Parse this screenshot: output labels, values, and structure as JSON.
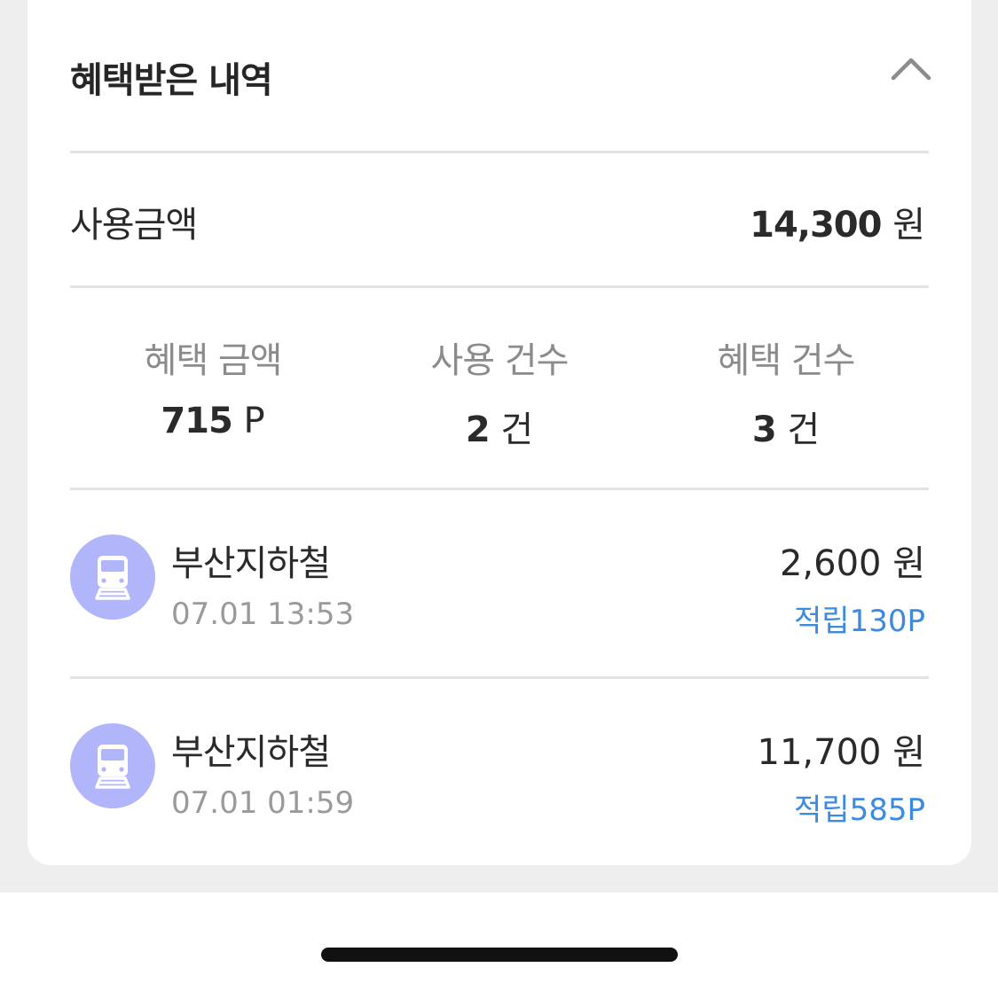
{
  "colors": {
    "page_background": "#eeeeee",
    "card_background": "#ffffff",
    "icon_circle": "#b1b6fb",
    "reward_text": "#3d8be0",
    "muted_text": "#9a9a9a"
  },
  "header": {
    "title": "혜택받은 내역",
    "collapse_icon": "chevron-up-icon"
  },
  "summary": {
    "total_label": "사용금액",
    "total_amount": "14,300",
    "total_unit": "원"
  },
  "stats": [
    {
      "label": "혜택 금액",
      "value": "715",
      "unit": "P"
    },
    {
      "label": "사용 건수",
      "value": "2",
      "unit": "건"
    },
    {
      "label": "혜택 건수",
      "value": "3",
      "unit": "건"
    }
  ],
  "transactions": [
    {
      "icon": "train-icon",
      "name": "부산지하철",
      "time": "07.01 13:53",
      "amount": "2,600 원",
      "reward": "적립130P"
    },
    {
      "icon": "train-icon",
      "name": "부산지하철",
      "time": "07.01 01:59",
      "amount": "11,700 원",
      "reward": "적립585P"
    }
  ]
}
